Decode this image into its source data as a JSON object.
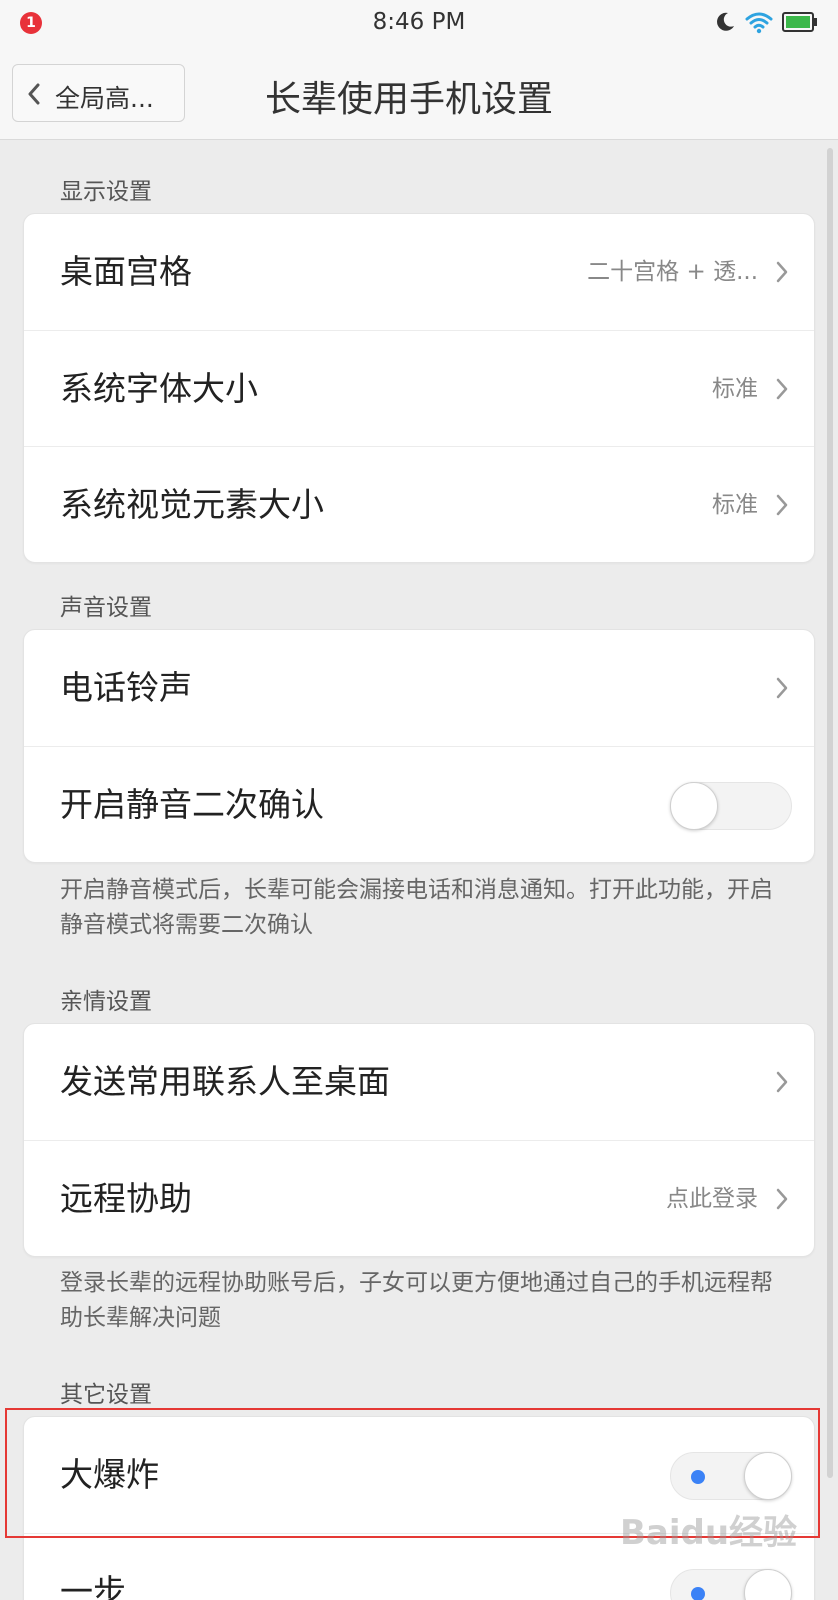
{
  "status_bar": {
    "notification_count": "1",
    "time": "8:46 PM",
    "icons": [
      "moon-icon",
      "wifi-icon",
      "battery-icon"
    ]
  },
  "header": {
    "back_label": "全局高...",
    "title": "长辈使用手机设置"
  },
  "sections": {
    "display": {
      "header": "显示设置",
      "rows": [
        {
          "label": "桌面宫格",
          "value": "二十宫格 + 透..."
        },
        {
          "label": "系统字体大小",
          "value": "标准"
        },
        {
          "label": "系统视觉元素大小",
          "value": "标准"
        }
      ]
    },
    "sound": {
      "header": "声音设置",
      "rows": [
        {
          "label": "电话铃声"
        },
        {
          "label": "开启静音二次确认",
          "toggle": "off"
        }
      ],
      "note": "开启静音模式后，长辈可能会漏接电话和消息通知。打开此功能，开启静音模式将需要二次确认"
    },
    "family": {
      "header": "亲情设置",
      "rows": [
        {
          "label": "发送常用联系人至桌面"
        },
        {
          "label": "远程协助",
          "value": "点此登录"
        }
      ],
      "note": "登录长辈的远程协助账号后，子女可以更方便地通过自己的手机远程帮助长辈解决问题"
    },
    "other": {
      "header": "其它设置",
      "rows": [
        {
          "label": "大爆炸",
          "toggle": "on"
        },
        {
          "label": "一步",
          "toggle": "on"
        }
      ]
    }
  },
  "watermark": "Baidu经验",
  "colors": {
    "accent": "#3b82f6",
    "highlight": "#e53935",
    "background": "#ececec",
    "badge": "#e8323a"
  }
}
